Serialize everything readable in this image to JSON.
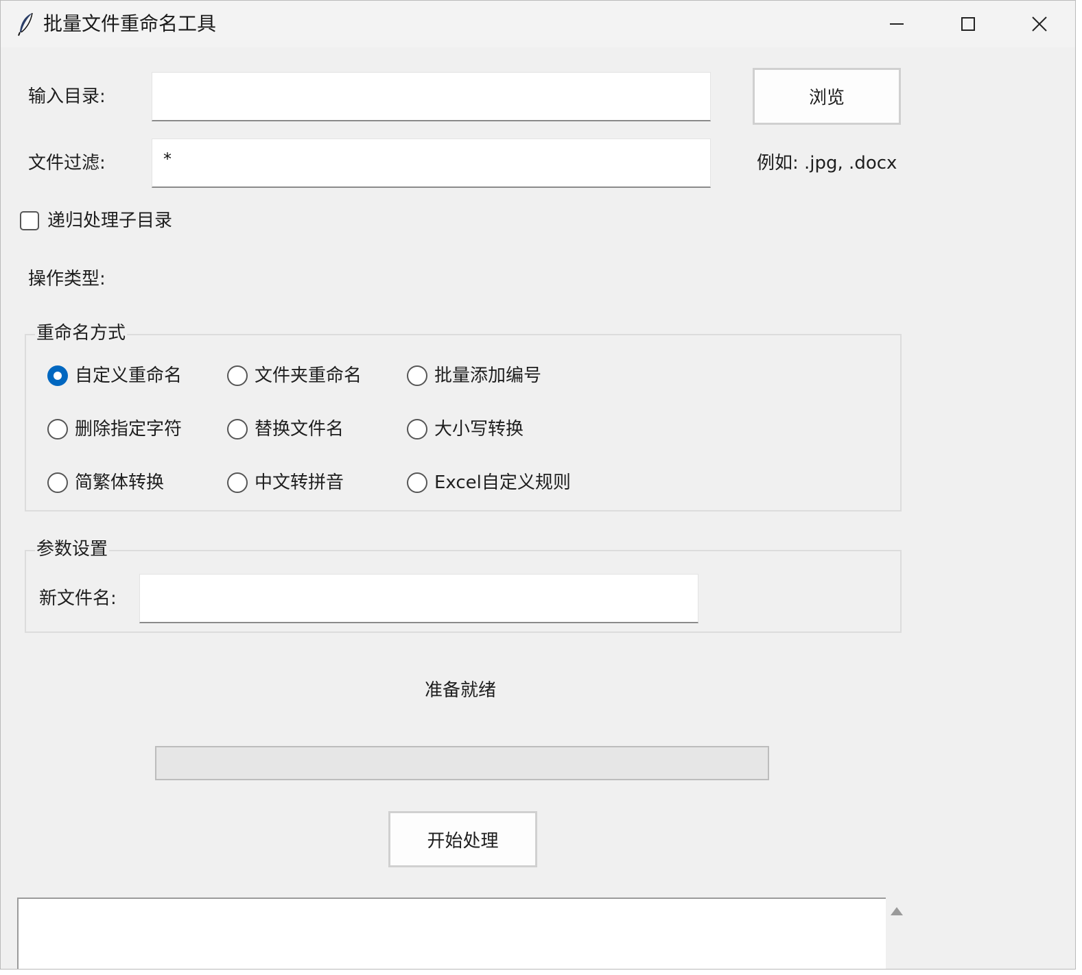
{
  "window": {
    "title": "批量文件重命名工具",
    "controls": [
      "minimize-icon",
      "maximize-icon",
      "close-icon"
    ]
  },
  "form": {
    "input_dir": {
      "label": "输入目录:",
      "value": ""
    },
    "browse_button": "浏览",
    "file_filter": {
      "label": "文件过滤:",
      "value": "*",
      "hint": "例如: .jpg, .docx"
    },
    "recursive": {
      "label": "递归处理子目录",
      "checked": false
    },
    "operation_type_label": "操作类型:"
  },
  "rename_mode": {
    "title": "重命名方式",
    "options": [
      {
        "label": "自定义重命名",
        "selected": true
      },
      {
        "label": "文件夹重命名",
        "selected": false
      },
      {
        "label": "批量添加编号",
        "selected": false
      },
      {
        "label": "删除指定字符",
        "selected": false
      },
      {
        "label": "替换文件名",
        "selected": false
      },
      {
        "label": "大小写转换",
        "selected": false
      },
      {
        "label": "简繁体转换",
        "selected": false
      },
      {
        "label": "中文转拼音",
        "selected": false
      },
      {
        "label": "Excel自定义规则",
        "selected": false
      }
    ]
  },
  "params": {
    "title": "参数设置",
    "new_name": {
      "label": "新文件名:",
      "value": ""
    }
  },
  "status": {
    "text": "准备就绪",
    "progress": 0
  },
  "start_button": "开始处理",
  "log": {
    "text": ""
  },
  "colors": {
    "accent": "#0067c0",
    "background": "#f0f0f0",
    "titlebar": "#f3f3f3"
  }
}
